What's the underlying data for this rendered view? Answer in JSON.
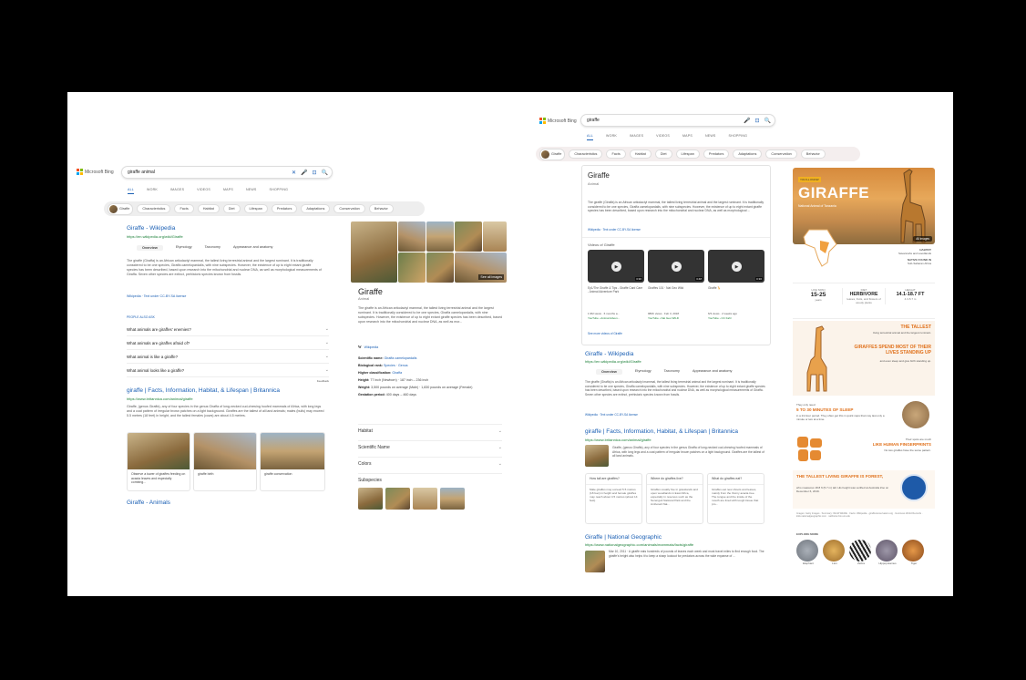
{
  "colors": {
    "accent": "#1a5fb4",
    "url": "#1a7f37",
    "orange": "#e0701a",
    "bg": "#000000"
  },
  "left": {
    "logo": "Microsoft Bing",
    "query": "giraffe animal",
    "scopes": [
      "ALL",
      "WORK",
      "IMAGES",
      "VIDEOS",
      "MAPS",
      "NEWS",
      "SHOPPING"
    ],
    "chips": [
      "Giraffe",
      "Characteristics",
      "Facts",
      "Habitat",
      "Diet",
      "Lifespan",
      "Predators",
      "Adaptations",
      "Conservation",
      "Behavior"
    ],
    "result1": {
      "title": "Giraffe - Wikipedia",
      "url": "https://en.wikipedia.org/wiki/Giraffe",
      "tabs": [
        "Overview",
        "Etymology",
        "Taxonomy",
        "Appearance and anatomy"
      ],
      "snippet": "The giraffe (Giraffa) is an African artiodactyl mammal, the tallest living terrestrial animal and the largest ruminant. It is traditionally considered to be one species, Giraffa camelopardalis, with nine subspecies. However, the existence of up to eight extant giraffe species has been described, based upon research into the mitochondrial and nuclear DNA, as well as morphological measurements of Giraffa. Seven other species are extinct, prehistoric species known from fossils.",
      "license": "Wikipedia · Text under CC-BY-SA license"
    },
    "paa": {
      "heading": "PEOPLE ALSO ASK",
      "questions": [
        "What animals are giraffes' enemies?",
        "What animals are giraffes afraid of?",
        "What animal is like a giraffe?",
        "What animal looks like a giraffe?"
      ],
      "feedback": "Feedback"
    },
    "result2": {
      "title": "giraffe | Facts, Information, Habitat, & Lifespan | Britannica",
      "url": "https://www.britannica.com/animal/giraffe",
      "snippet": "Giraffe, (genus Giraffa), any of four species in the genus Giraffa of long-necked cud-chewing hoofed mammals of Africa, with long legs and a coat pattern of irregular brown patches on a light background. Giraffes are the tallest of all land animals; males (bulls) may exceed 5.5 metres (18 feet) in height, and the tallest females (cows) are about 4.5 metres.",
      "cards": [
        "Observe a tower of giraffes feeding on acacia leaves and especially combing...",
        "giraffe birth",
        "giraffe conservation"
      ]
    },
    "result3": {
      "title": "Giraffe - Animals"
    },
    "kp": {
      "title": "Giraffe",
      "subtitle": "Animal",
      "see_all": "See all images",
      "desc": "The giraffe is an African artiodactyl mammal, the tallest living terrestrial animal and the largest ruminant. It is traditionally considered to be one species, Giraffa camelopardalis, with nine subspecies. However, the existence of up to eight extant giraffe species has been described, based upon research into the mitochondrial and nuclear DNA, as well as mor...",
      "wiki": "Wikipedia",
      "facts": [
        {
          "k": "Scientific name:",
          "v": "Giraffa camelopardalis"
        },
        {
          "k": "Biological rank:",
          "v": "Species · Genus"
        },
        {
          "k": "Higher classification:",
          "v": "Giraffa"
        },
        {
          "k": "Height:",
          "v": "77 inch (Newborn) · 187 inch – 236 inch"
        },
        {
          "k": "Weight:",
          "v": "3,500 pounds on average (Male) · 1,830 pounds on average (Female)"
        },
        {
          "k": "Gestation period:",
          "v": "400 days – 460 days"
        }
      ],
      "sections": [
        "Habitat",
        "Scientific Name",
        "Colors",
        "Subspecies"
      ]
    }
  },
  "right": {
    "logo": "Microsoft Bing",
    "query": "giraffe",
    "scopes": [
      "ALL",
      "WORK",
      "IMAGES",
      "VIDEOS",
      "MAPS",
      "NEWS",
      "SHOPPING"
    ],
    "chips": [
      "Giraffe",
      "Characteristics",
      "Facts",
      "Habitat",
      "Diet",
      "Lifespan",
      "Predators",
      "Adaptations",
      "Conservation",
      "Behavior"
    ],
    "entity": {
      "title": "Giraffe",
      "subtitle": "Animal",
      "desc": "The giraffe (Giraffa) is an African artiodactyl mammal, the tallest living terrestrial animal and the largest ruminant. It is traditionally considered to be one species, Giraffa camelopardalis, with nine subspecies. However, the existence of up to eight extant giraffe species has been described, based upon research into the mitochondrial and nuclear DNA, as well as morphological ...",
      "license": "Wikipedia · Text under CC-BY-SA license"
    },
    "videos": {
      "heading": "Videos of Giraffe",
      "items": [
        {
          "title": "Ep1/The Giraffe & Tips - Giraffe Card Care - Animal Adventure Park",
          "meta": "1.9M views · 6 months a...",
          "src": "YouTube › Animal Adven...",
          "dur": "3:30"
        },
        {
          "title": "Giraffes 101 · Nat Geo Wild",
          "meta": "980K views · Feb 3, 2018",
          "src": "YouTube › Nat Geo WILD",
          "dur": "3:48"
        },
        {
          "title": "Giraffe 🦒",
          "meta": "6/3 views · 2 weeks ago",
          "src": "YouTube › CC Fahl",
          "dur": "0:30"
        }
      ],
      "more": "See more videos of Giraffe"
    },
    "result1": {
      "title": "Giraffe - Wikipedia",
      "url": "https://en.wikipedia.org/wiki/Giraffe",
      "tabs": [
        "Overview",
        "Etymology",
        "Taxonomy",
        "Appearance and anatomy"
      ],
      "snippet": "The giraffe (Giraffa) is an African artiodactyl mammal, the tallest living terrestrial animal and the largest ruminant. It is traditionally considered to be one species, Giraffa camelopardalis, with nine subspecies. However, the existence of up to eight extant giraffe species has been described, based upon research into the mitochondrial and nuclear DNA, as well as morphological measurements of Giraffa. Seven other species are extinct, prehistoric species known from fossils.",
      "license": "Wikipedia · Text under CC-BY-SA license"
    },
    "result2": {
      "title": "giraffe | Facts, Information, Habitat, & Lifespan | Britannica",
      "url": "https://www.britannica.com/animal/giraffe",
      "snippet": "Giraffe, (genus Giraffa), any of four species in the genus Giraffa of long-necked cud-chewing hoofed mammals of Africa, with long legs and a coat pattern of irregular brown patches on a light background. Giraffes are the tallest of all land animals.",
      "qa": [
        {
          "q": "How tall are giraffes?",
          "a": "Male giraffes may exceed 5.5 metres (18 feet) in height and female giraffes may reach about 4.5 metres (about 14 feet)."
        },
        {
          "q": "Where do giraffes live?",
          "a": "Giraffes usually live in grasslands and open woodlands in East Africa, especially in reserves such as the Serengeti National Park and the Amboseli Nat..."
        },
        {
          "q": "What do giraffes eat?",
          "a": "Giraffes eat new shoots and leaves, mainly from the thorny acacia tree. The tongue and the inside of the mouth are lined with tough tissue that pro..."
        }
      ]
    },
    "result3": {
      "title": "Giraffe | National Geographic",
      "url": "https://www.nationalgeographic.com/animals/mammals/facts/giraffe",
      "snippet": "Mar 10, 2011 · A giraffe eats hundreds of pounds of leaves each week and must travel miles to find enough food. The giraffe's height also helps it to keep a sharp lookout for predators across the wide expanse of ..."
    },
    "infographic": {
      "badge": "YOU’LL KNOW",
      "title": "GIRAFFE",
      "subtitle": "National Animal of Tanzania",
      "all_images": "All images",
      "habitat_label": "HABITAT",
      "habitat": "Savannahs and woodlands",
      "range_label": "NATIVE FOUND IN",
      "range": "Sub-Saharan Africa",
      "stats": [
        {
          "l": "LIFE SPAN",
          "v": "15-25",
          "u": "years"
        },
        {
          "l": "DIET",
          "v": "HERBIVORE",
          "u": "leaves, fruits, and flowers of woody plants"
        },
        {
          "l": "HEIGHT",
          "v": "14.1-18.7 FT",
          "u": "4.3-5.7 m"
        }
      ],
      "f1": "THE TALLEST",
      "f1s": "living terrestrial animal and the largest ruminant.",
      "f2": "GIRAFFES SPEND MOST OF THEIR LIVES STANDING UP",
      "f2s": "and even sleep and give birth standing up.",
      "f3a": "They only need",
      "f3": "5 TO 30 MINUTES OF SLEEP",
      "f3s": "in a 24-hour period. They often get this in quick naps that may last only a minute or two at a time.",
      "f4a": "Their spots are much",
      "f4": "LIKE HUMAN FINGERPRINTS",
      "f4s": "No two giraffes have the same pattern.",
      "f5": "THE TALLEST LIVING GIRAFFE IS FOREST,",
      "f5s": "who measures 18.8 ft (5.7 m) tall. His height was verified at Australia Zoo on December 6, 2019.",
      "credits": "Images: Getty Images · Summary: World Wildlife · Facts: Wikipedia · giraffeconservation.org · Guinness World Records · kids.nationalgeographic.com · nathistoc.bio.uci.edu",
      "explore": "EXPLORE MORE",
      "animals": [
        "Elephant",
        "Lion",
        "Zebra",
        "Hippopotamus",
        "Tiger"
      ]
    }
  }
}
